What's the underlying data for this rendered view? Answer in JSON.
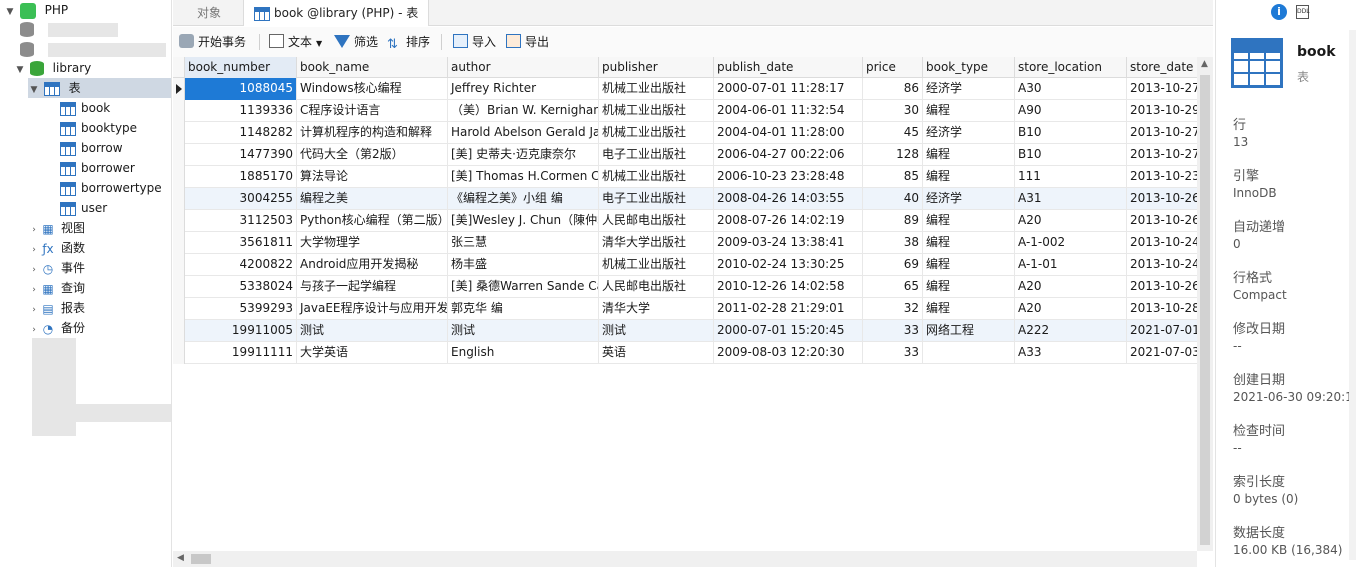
{
  "tree": {
    "connection": "PHP",
    "database": "library",
    "tables_node": "表",
    "tables": [
      "book",
      "booktype",
      "borrow",
      "borrower",
      "borrowertype",
      "user"
    ],
    "other_nodes": [
      "视图",
      "函数",
      "事件",
      "查询",
      "报表",
      "备份"
    ]
  },
  "tabs": {
    "objects": "对象",
    "active": "book @library (PHP) - 表"
  },
  "toolbar": {
    "begin_transaction": "开始事务",
    "text": "文本",
    "filter": "筛选",
    "sort": "排序",
    "import": "导入",
    "export": "导出"
  },
  "grid": {
    "columns": [
      "book_number",
      "book_name",
      "author",
      "publisher",
      "publish_date",
      "price",
      "book_type",
      "store_location",
      "store_date"
    ],
    "rows": [
      [
        "1088045",
        "Windows核心编程",
        "Jeffrey Richter",
        "机械工业出版社",
        "2000-07-01 11:28:17",
        "86",
        "经济学",
        "A30",
        "2013-10-27"
      ],
      [
        "1139336",
        "C程序设计语言",
        "（美）Brian W. Kernighan",
        "机械工业出版社",
        "2004-06-01 11:32:54",
        "30",
        "编程",
        "A90",
        "2013-10-29"
      ],
      [
        "1148282",
        "计算机程序的构造和解释",
        "Harold Abelson Gerald Ja",
        "机械工业出版社",
        "2004-04-01 11:28:00",
        "45",
        "经济学",
        "B10",
        "2013-10-27"
      ],
      [
        "1477390",
        "代码大全（第2版）",
        "[美] 史蒂夫·迈克康奈尔",
        "电子工业出版社",
        "2006-04-27 00:22:06",
        "128",
        "编程",
        "B10",
        "2013-10-27"
      ],
      [
        "1885170",
        "算法导论",
        "[美] Thomas H.Cormen Ch",
        "机械工业出版社",
        "2006-10-23 23:28:48",
        "85",
        "编程",
        "111",
        "2013-10-23"
      ],
      [
        "3004255",
        "编程之美",
        "《编程之美》小组 编",
        "电子工业出版社",
        "2008-04-26 14:03:55",
        "40",
        "经济学",
        "A31",
        "2013-10-26"
      ],
      [
        "3112503",
        "Python核心编程（第二版）",
        "[美]Wesley J. Chun（陳仲才",
        "人民邮电出版社",
        "2008-07-26 14:02:19",
        "89",
        "编程",
        "A20",
        "2013-10-26"
      ],
      [
        "3561811",
        "大学物理学",
        "张三慧",
        "清华大学出版社",
        "2009-03-24 13:38:41",
        "38",
        "编程",
        "A-1-002",
        "2013-10-24"
      ],
      [
        "4200822",
        "Android应用开发揭秘",
        "杨丰盛",
        "机械工业出版社",
        "2010-02-24 13:30:25",
        "69",
        "编程",
        "A-1-01",
        "2013-10-24"
      ],
      [
        "5338024",
        "与孩子一起学编程",
        "[美] 桑德Warren Sande Ca",
        "人民邮电出版社",
        "2010-12-26 14:02:58",
        "65",
        "编程",
        "A20",
        "2013-10-26"
      ],
      [
        "5399293",
        "JavaEE程序设计与应用开发",
        "郭克华 编",
        "清华大学",
        "2011-02-28 21:29:01",
        "32",
        "编程",
        "A20",
        "2013-10-28"
      ],
      [
        "19911005",
        "测试",
        "测试",
        "测试",
        "2000-07-01 15:20:45",
        "33",
        "网络工程",
        "A222",
        "2021-07-01"
      ],
      [
        "19911111",
        "大学英语",
        "English",
        "英语",
        "2009-08-03 12:20:30",
        "33",
        "",
        "A33",
        "2021-07-03"
      ]
    ]
  },
  "info": {
    "name": "book",
    "type": "表",
    "props": [
      {
        "label": "行",
        "value": "13"
      },
      {
        "label": "引擎",
        "value": "InnoDB"
      },
      {
        "label": "自动递增",
        "value": "0"
      },
      {
        "label": "行格式",
        "value": "Compact"
      },
      {
        "label": "修改日期",
        "value": "--"
      },
      {
        "label": "创建日期",
        "value": "2021-06-30 09:20:1"
      },
      {
        "label": "检查时间",
        "value": "--"
      },
      {
        "label": "索引长度",
        "value": "0 bytes (0)"
      },
      {
        "label": "数据长度",
        "value": "16.00 KB (16,384)"
      }
    ]
  }
}
